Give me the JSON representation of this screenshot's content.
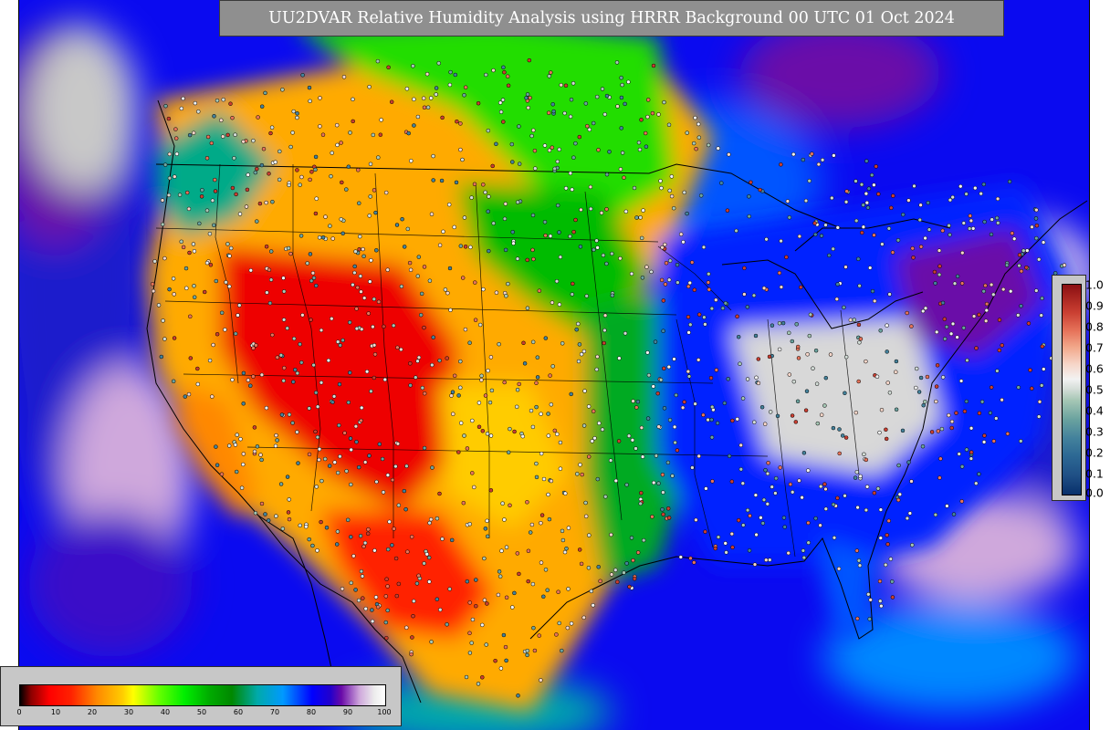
{
  "title": "UU2DVAR Relative Humidity Analysis using HRRR Background 00 UTC 01 Oct 2024",
  "legends": {
    "observations": {
      "orientation": "vertical",
      "placement": "right",
      "ticks": [
        "1.0",
        "0.9",
        "0.8",
        "0.7",
        "0.6",
        "0.5",
        "0.4",
        "0.3",
        "0.2",
        "0.1",
        "0.0"
      ],
      "colors": [
        "#08306b",
        "#2c6793",
        "#6ba39f",
        "#f2f2f2",
        "#e6735a",
        "#8b0f12"
      ]
    },
    "relative_humidity": {
      "orientation": "horizontal",
      "placement": "bottom-left",
      "ticks": [
        "0",
        "10",
        "20",
        "30",
        "40",
        "50",
        "60",
        "70",
        "80",
        "90",
        "100"
      ],
      "colors": [
        "#000000",
        "#ff0000",
        "#ff8800",
        "#ffff00",
        "#00ee00",
        "#008800",
        "#0099ff",
        "#0000ff",
        "#6a0aa8",
        "#ffffff"
      ]
    }
  },
  "map": {
    "projection": "Lambert conformal",
    "region": "CONUS",
    "ocean_color": "#0000ee",
    "land_outline_color": "#000000",
    "observation_marker": "circle"
  }
}
